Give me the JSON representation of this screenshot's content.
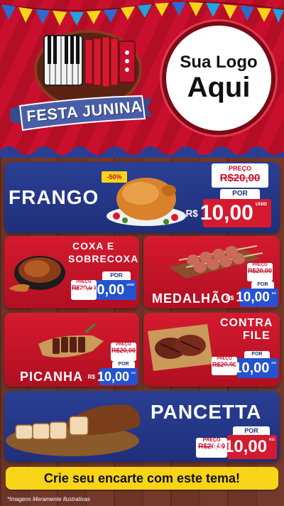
{
  "header": {
    "festa_title": "FESTA JUNINA",
    "logo_line1": "Sua Logo",
    "logo_line2": "Aqui"
  },
  "products": {
    "frango": {
      "name": "FRANGO",
      "discount": "-50%",
      "preco_label": "PREÇO",
      "old_price": "R$20,00",
      "por_label": "POR",
      "currency": "R$",
      "new_price": "10,00",
      "unit": "UNID"
    },
    "coxa": {
      "name_line1": "COXA E",
      "name_line2": "SOBRECOXA",
      "preco_label": "PREÇO",
      "old_price": "R$20,00",
      "por_label": "POR",
      "currency": "R$",
      "new_price": "10,00",
      "unit": "UNID"
    },
    "medalhao": {
      "name": "MEDALHÃO",
      "preco_label": "PREÇO",
      "old_price": "R$20,00",
      "por_label": "POR",
      "currency": "R$",
      "new_price": "10,00",
      "unit": "KG"
    },
    "picanha": {
      "name": "PICANHA",
      "preco_label": "PREÇO",
      "old_price": "R$20,00",
      "por_label": "POR",
      "currency": "R$",
      "new_price": "10,00",
      "unit": "KG"
    },
    "contra_file": {
      "name_line1": "CONTRA",
      "name_line2": "FILE",
      "preco_label": "PREÇO",
      "old_price": "R$20,00",
      "por_label": "POR",
      "currency": "R$",
      "new_price": "10,00",
      "unit": "KG"
    },
    "pancetta": {
      "name": "PANCETTA",
      "preco_label": "PREÇO",
      "old_price": "R$20,00",
      "por_label": "POR",
      "currency": "R$",
      "new_price": "10,00",
      "unit": "KG"
    }
  },
  "cta": {
    "label": "Crie seu encarte com este tema!"
  },
  "footnote": "*Imagens Meramente Ilustrativas",
  "colors": {
    "red": "#c8102e",
    "blue": "#1f2f7a",
    "yellow": "#f7d417"
  }
}
